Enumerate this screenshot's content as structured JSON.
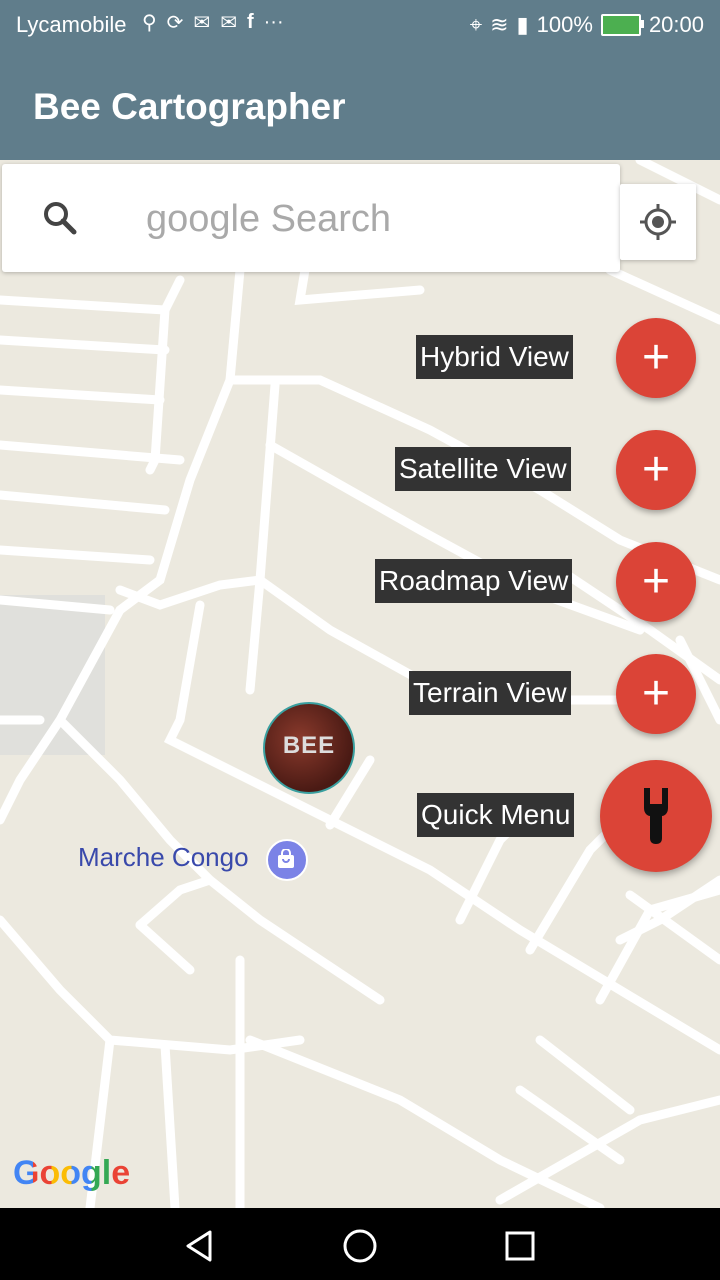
{
  "status": {
    "carrier": "Lycamobile",
    "battery": "100%",
    "time": "20:00",
    "left_icons": [
      "usb-icon",
      "sync-icon",
      "mail-icon",
      "gmail-icon",
      "facebook-icon",
      "more-icon"
    ],
    "right_icons": [
      "location-icon",
      "wifi-icon",
      "signal-icon",
      "battery-icon"
    ]
  },
  "appbar": {
    "title": "Bee Cartographer"
  },
  "search": {
    "placeholder": "google Search"
  },
  "fab_menu": {
    "items": [
      {
        "label": "Hybrid View"
      },
      {
        "label": "Satellite View"
      },
      {
        "label": "Roadmap View"
      },
      {
        "label": "Terrain View"
      }
    ],
    "main_label": "Quick Menu",
    "plus": "+"
  },
  "map": {
    "marker_text": "BEE",
    "place_label": "Marche Congo",
    "attribution": "Google"
  },
  "colors": {
    "appbar": "#607d8b",
    "fab": "#db4437",
    "map_bg": "#ece9df",
    "place_text": "#3949ab"
  }
}
